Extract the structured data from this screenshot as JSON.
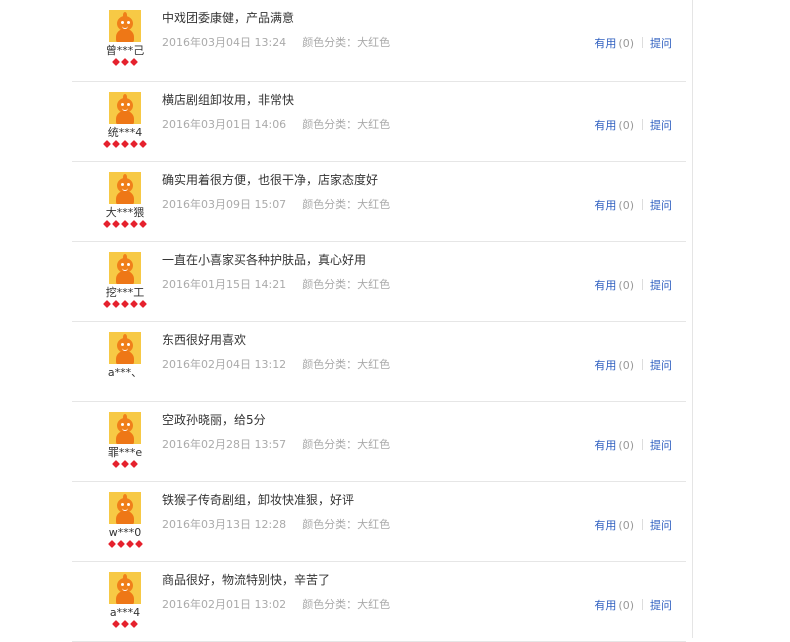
{
  "reviews": [
    {
      "user": "曾***己",
      "hearts": 3,
      "content": "中戏团委康健，产品满意",
      "date": "2016年03月04日 13:24",
      "color_label": "颜色分类：大红色",
      "useful_label": "有用",
      "useful_count": "(0)",
      "ask_label": "提问"
    },
    {
      "user": "统***4",
      "hearts": 5,
      "content": "横店剧组卸妆用，非常快",
      "date": "2016年03月01日 14:06",
      "color_label": "颜色分类：大红色",
      "useful_label": "有用",
      "useful_count": "(0)",
      "ask_label": "提问"
    },
    {
      "user": "大***猥",
      "hearts": 5,
      "content": "确实用着很方便，也很干净，店家态度好",
      "date": "2016年03月09日 15:07",
      "color_label": "颜色分类：大红色",
      "useful_label": "有用",
      "useful_count": "(0)",
      "ask_label": "提问"
    },
    {
      "user": "挖***工",
      "hearts": 5,
      "content": "一直在小喜家买各种护肤品，真心好用",
      "date": "2016年01月15日 14:21",
      "color_label": "颜色分类：大红色",
      "useful_label": "有用",
      "useful_count": "(0)",
      "ask_label": "提问"
    },
    {
      "user": "a***、",
      "hearts": 0,
      "content": "东西很好用喜欢",
      "date": "2016年02月04日 13:12",
      "color_label": "颜色分类：大红色",
      "useful_label": "有用",
      "useful_count": "(0)",
      "ask_label": "提问"
    },
    {
      "user": "罪***e",
      "hearts": 3,
      "content": "空政孙晓丽，给5分",
      "date": "2016年02月28日 13:57",
      "color_label": "颜色分类：大红色",
      "useful_label": "有用",
      "useful_count": "(0)",
      "ask_label": "提问"
    },
    {
      "user": "w***0",
      "hearts": 4,
      "content": "铁猴子传奇剧组，卸妆快准狠，好评",
      "date": "2016年03月13日 12:28",
      "color_label": "颜色分类：大红色",
      "useful_label": "有用",
      "useful_count": "(0)",
      "ask_label": "提问"
    },
    {
      "user": "a***4",
      "hearts": 3,
      "content": "商品很好，物流特别快，辛苦了",
      "date": "2016年02月01日 13:02",
      "color_label": "颜色分类：大红色",
      "useful_label": "有用",
      "useful_count": "(0)",
      "ask_label": "提问"
    }
  ],
  "colors": {
    "accent_link": "#3060c0",
    "heart": "#e5212d",
    "avatar_bg": "#f7c945",
    "avatar_figure": "#f07f1a"
  }
}
